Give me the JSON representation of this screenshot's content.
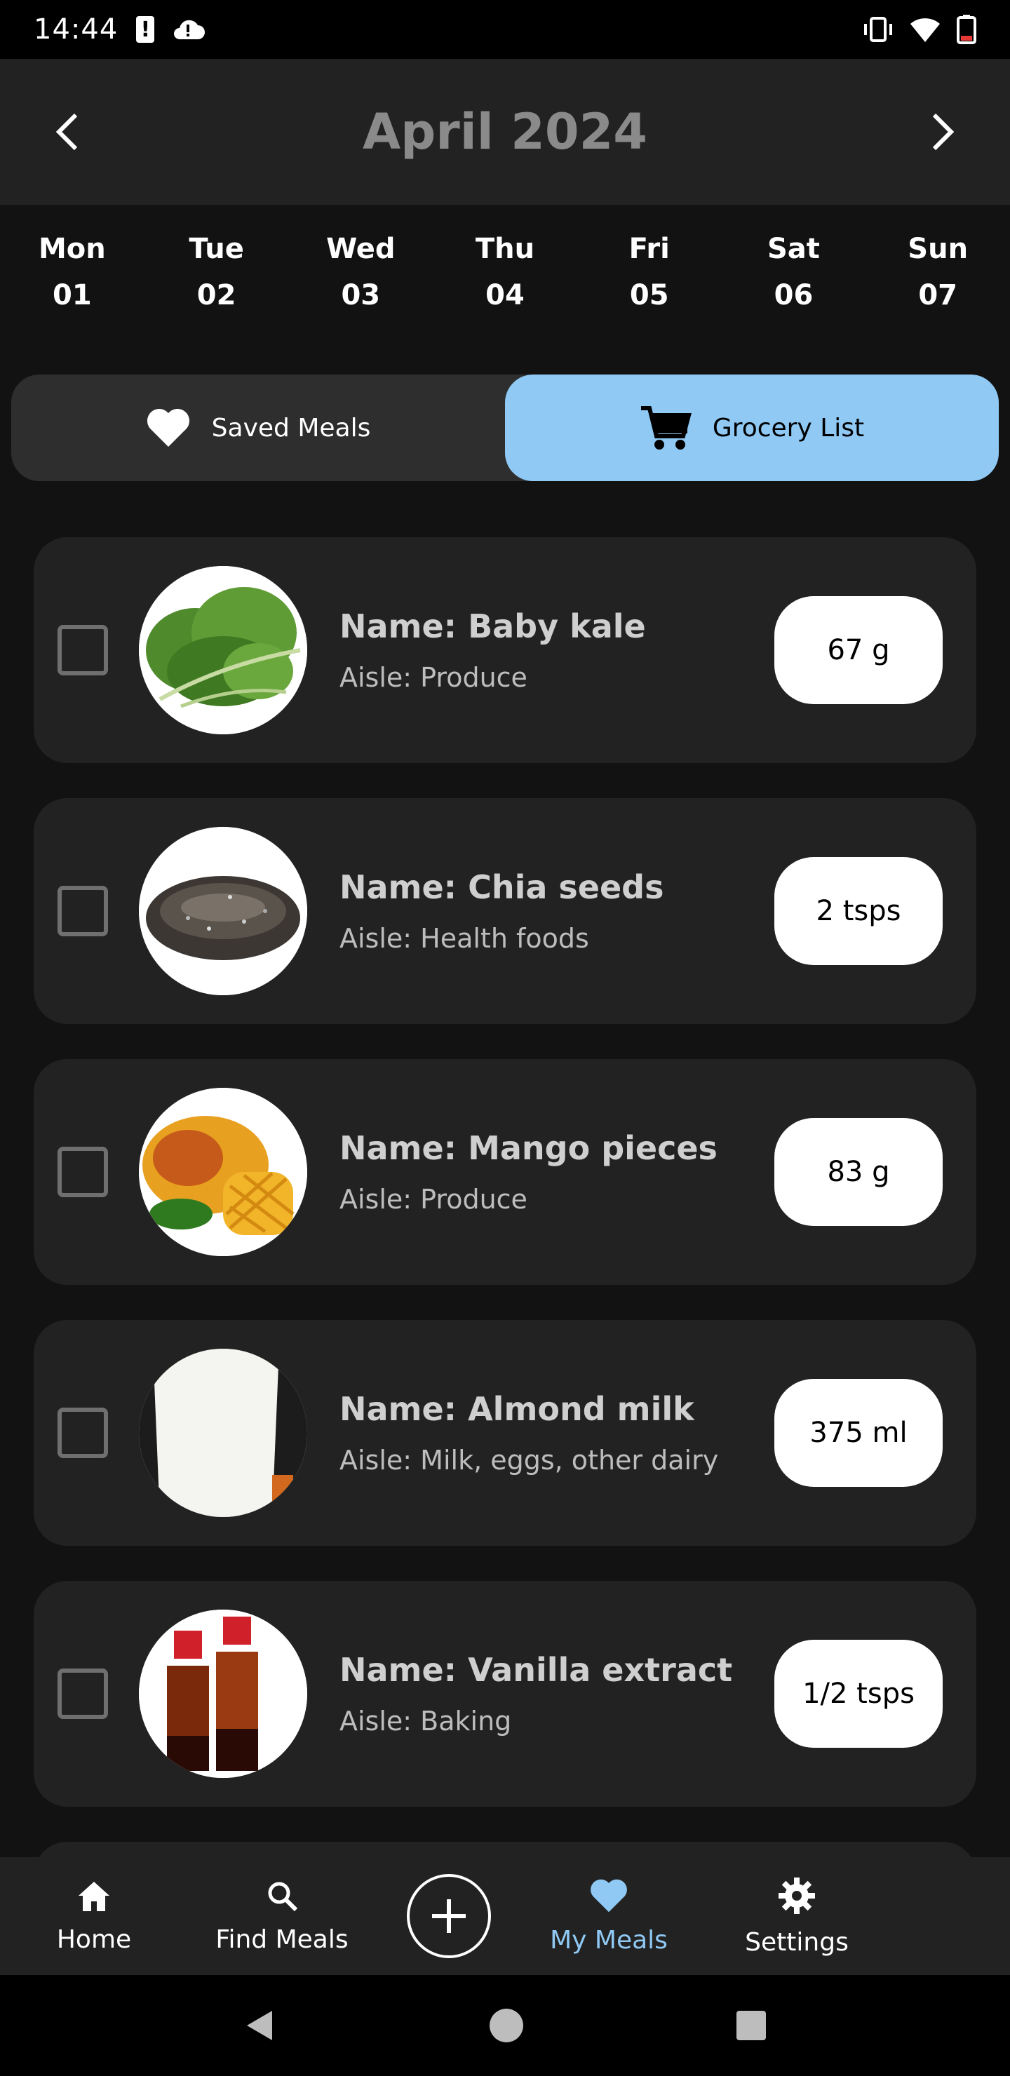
{
  "status": {
    "time": "14:44"
  },
  "header": {
    "month_label": "April 2024"
  },
  "week": [
    {
      "day": "Mon",
      "date": "01"
    },
    {
      "day": "Tue",
      "date": "02"
    },
    {
      "day": "Wed",
      "date": "03"
    },
    {
      "day": "Thu",
      "date": "04"
    },
    {
      "day": "Fri",
      "date": "05"
    },
    {
      "day": "Sat",
      "date": "06"
    },
    {
      "day": "Sun",
      "date": "07"
    }
  ],
  "tabs": {
    "saved_meals": "Saved Meals",
    "grocery_list": "Grocery List",
    "active": "grocery_list"
  },
  "grocery": [
    {
      "name": "Name: Baby kale",
      "aisle": "Aisle: Produce",
      "qty": "67 g",
      "image_icon": "kale-image"
    },
    {
      "name": "Name: Chia seeds",
      "aisle": "Aisle: Health foods",
      "qty": "2 tsps",
      "image_icon": "chia-seeds-image"
    },
    {
      "name": "Name: Mango pieces",
      "aisle": "Aisle: Produce",
      "qty": "83 g",
      "image_icon": "mango-image"
    },
    {
      "name": "Name: Almond milk",
      "aisle": "Aisle: Milk, eggs, other dairy",
      "qty": "375 ml",
      "image_icon": "almond-milk-image"
    },
    {
      "name": "Name: Vanilla extract",
      "aisle": "Aisle: Baking",
      "qty": "1/2 tsps",
      "image_icon": "vanilla-extract-image"
    }
  ],
  "bottom_nav": {
    "home": "Home",
    "find_meals": "Find Meals",
    "my_meals": "My Meals",
    "settings": "Settings",
    "active": "my_meals"
  },
  "colors": {
    "accent": "#8fc9f4",
    "background": "#121212",
    "card": "#222222"
  }
}
